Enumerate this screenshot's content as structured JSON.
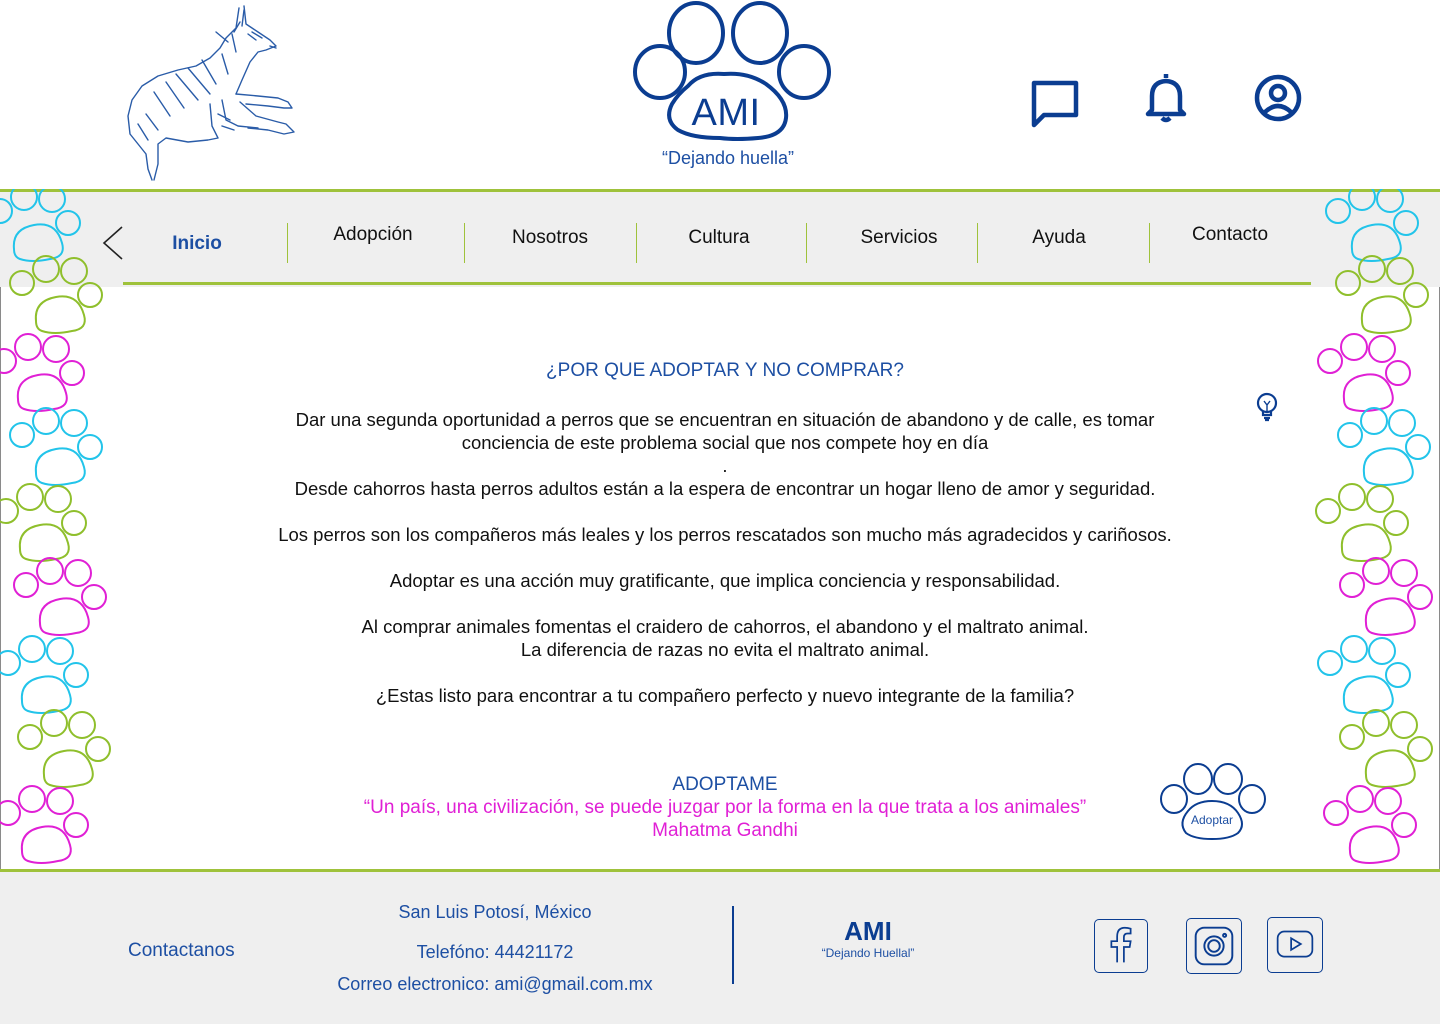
{
  "header": {
    "brand": "AMI",
    "slogan": "“Dejando huella”"
  },
  "nav": {
    "items": [
      {
        "label": "Inicio",
        "active": true
      },
      {
        "label": "Adopción"
      },
      {
        "label": "Nosotros"
      },
      {
        "label": "Cultura"
      },
      {
        "label": "Servicios"
      },
      {
        "label": "Ayuda"
      },
      {
        "label": "Contacto"
      }
    ]
  },
  "main": {
    "heading": "¿POR QUE ADOPTAR Y NO COMPRAR?",
    "p1_line1": "Dar una segunda oportunidad a perros que se encuentran en situación de abandono y de calle, es tomar",
    "p1_line2": "conciencia de este problema social que nos compete hoy en día",
    "p1_line3": ".",
    "p2": "Desde cahorros hasta perros adultos están a la espera de encontrar un hogar lleno de amor y seguridad.",
    "p3": "Los perros son los compañeros más leales y los perros rescatados son mucho más agradecidos y cariñosos.",
    "p4": "Adoptar es una acción muy gratificante, que implica conciencia y responsabilidad.",
    "p5_line1": "Al comprar animales fomentas el craidero de cahorros, el abandono y el maltrato animal.",
    "p5_line2": "La diferencia de razas no evita el maltrato animal.",
    "p6": "¿Estas listo para encontrar a tu compañero perfecto y nuevo integrante de la familia?",
    "adoptame": "ADOPTAME",
    "quote": "“Un país, una civilización, se puede juzgar por la forma en la que trata a los animales”",
    "author": "Mahatma Gandhi",
    "adopt_button": "Adoptar"
  },
  "footer": {
    "contact_label": "Contactanos",
    "location": "San Luis Potosí, México",
    "phone": "Telefóno: 44421172",
    "email": "Correo electronico: ami@gmail.com.mx",
    "brand": "AMI",
    "slogan": "“Dejando Huellal”"
  },
  "colors": {
    "primary": "#0b3d91",
    "accent_green": "#9fc23b",
    "paw_cyan": "#22c4ea",
    "paw_magenta": "#e020d5",
    "paw_green": "#8fbf2c",
    "band_gray": "#efefef"
  }
}
